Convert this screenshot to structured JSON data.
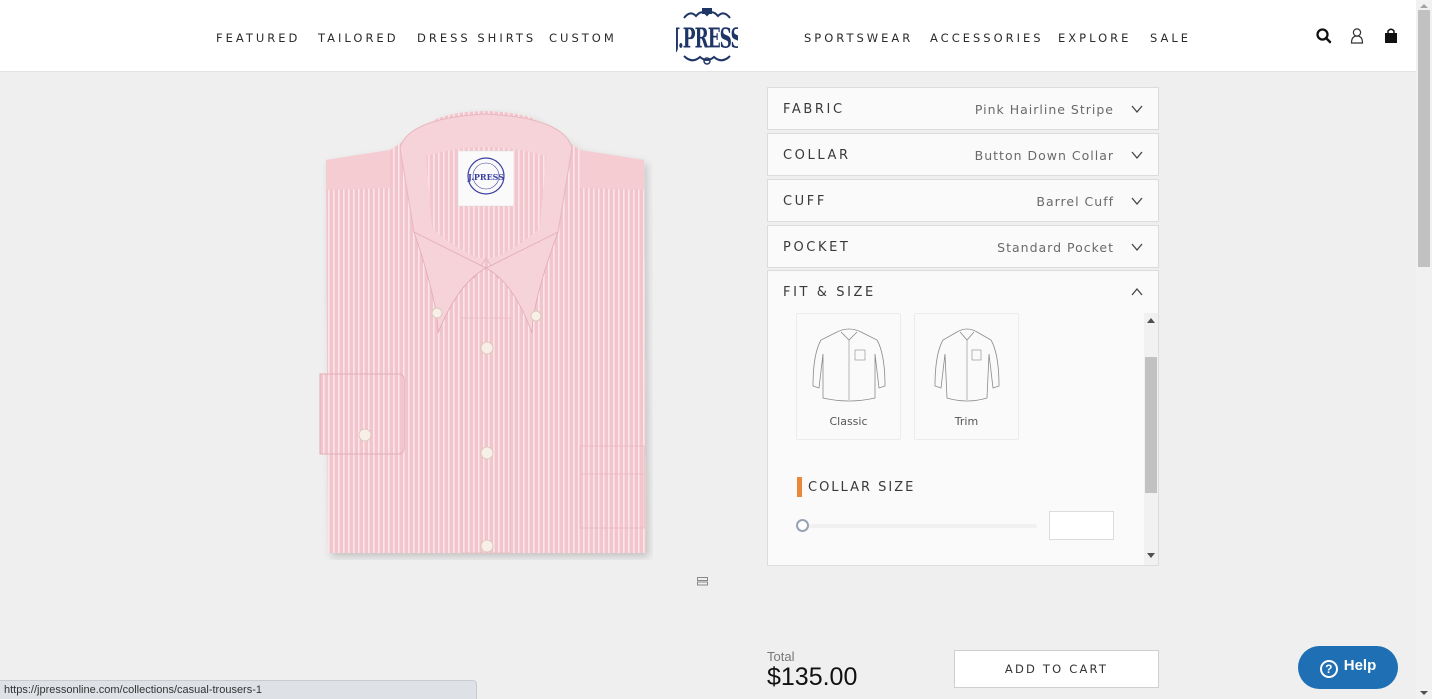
{
  "header": {
    "brand": "J.PRESS",
    "nav_left": [
      "FEATURED",
      "TAILORED",
      "DRESS SHIRTS",
      "CUSTOM"
    ],
    "nav_right": [
      "SPORTSWEAR",
      "ACCESSORIES",
      "EXPLORE",
      "SALE"
    ],
    "icons": [
      "search-icon",
      "account-icon",
      "shopping-bag-icon"
    ]
  },
  "product": {
    "image_alt": "Pink hairline stripe button down dress shirt, folded",
    "shirt_color": "#f2c4cb",
    "stripe_color": "#fbe6e9"
  },
  "options": [
    {
      "label": "FABRIC",
      "value": "Pink Hairline Stripe"
    },
    {
      "label": "COLLAR",
      "value": "Button Down Collar"
    },
    {
      "label": "CUFF",
      "value": "Barrel Cuff"
    },
    {
      "label": "POCKET",
      "value": "Standard Pocket"
    }
  ],
  "fit_size": {
    "label": "FIT & SIZE",
    "fits": [
      {
        "label": "Classic"
      },
      {
        "label": "Trim"
      }
    ],
    "collar_size": {
      "label": "COLLAR SIZE",
      "slider_value": 0,
      "input_value": "",
      "accent_color": "#e8883a"
    }
  },
  "footer": {
    "total_label": "Total",
    "total_price": "$135.00",
    "add_to_cart": "ADD TO CART",
    "help_label": "Help",
    "help_color": "#1e6fb3"
  },
  "status_bar": {
    "url": "https://jpressonline.com/collections/casual-trousers-1"
  }
}
